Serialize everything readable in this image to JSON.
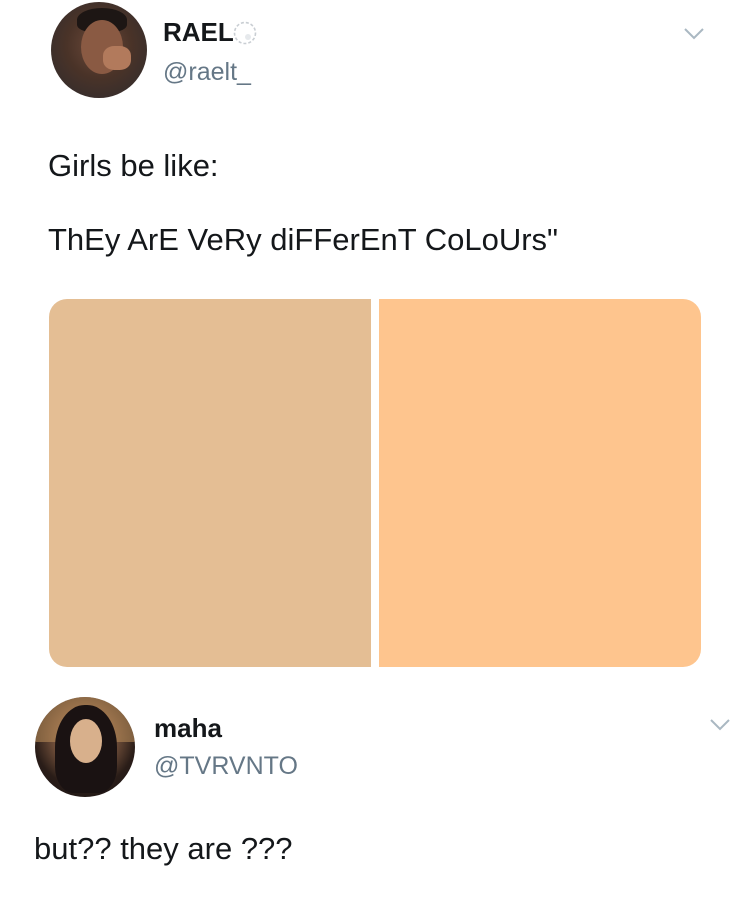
{
  "tweets": [
    {
      "display_name": "RAEL",
      "handle": "@raelt_",
      "name_emoji": "cloud-emoji-icon",
      "lines": [
        "Girls be like:",
        "ThEy ArE VeRy diFFerEnT CoLoUrs\""
      ],
      "media": {
        "left_color": "#E4BE94",
        "right_color": "#FEC58E"
      }
    },
    {
      "display_name": "maha",
      "handle": "@TVRVNTO",
      "lines": [
        "but?? they are ???"
      ]
    }
  ],
  "icons": {
    "menu": "chevron-down-icon"
  },
  "colors": {
    "text": "#14171A",
    "secondary": "#657786",
    "chevron": "#AAB8C2"
  }
}
